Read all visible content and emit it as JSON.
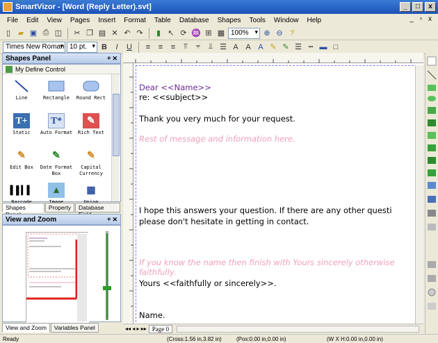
{
  "window": {
    "title": "SmartVizor - [Word (Reply Letter).svt]",
    "controls": [
      "_",
      "□",
      "x"
    ]
  },
  "menu": [
    "File",
    "Edit",
    "View",
    "Pages",
    "Insert",
    "Format",
    "Table",
    "Database",
    "Shapes",
    "Tools",
    "Window",
    "Help"
  ],
  "toolbar": {
    "zoom": "100%",
    "font_name": "Times New Roman",
    "font_size": "10 pt."
  },
  "shapes_panel": {
    "title": "Shapes Panel",
    "category": "My Define Control",
    "items": [
      {
        "label": "Line",
        "icon": "line-icon"
      },
      {
        "label": "Rectangle",
        "icon": "rectangle-icon"
      },
      {
        "label": "Round Rect",
        "icon": "round-rect-icon"
      },
      {
        "label": "Static",
        "icon": "static-text-icon"
      },
      {
        "label": "Auto Format",
        "icon": "auto-format-icon"
      },
      {
        "label": "Rich Text",
        "icon": "rich-text-icon"
      },
      {
        "label": "Edit Box",
        "icon": "edit-box-icon"
      },
      {
        "label": "Date Format Box",
        "icon": "date-format-icon"
      },
      {
        "label": "Capital Currency",
        "icon": "capital-currency-icon"
      },
      {
        "label": "Barcode",
        "icon": "barcode-icon"
      },
      {
        "label": "Image",
        "icon": "image-icon"
      },
      {
        "label": "Union",
        "icon": "union-icon"
      }
    ],
    "tabs": [
      "Shapes Panel",
      "Property",
      "Database Field"
    ]
  },
  "view_zoom": {
    "title": "View and Zoom",
    "tabs": [
      "View and Zoom",
      "Variables Panel"
    ]
  },
  "document": {
    "lines": [
      {
        "text": "Dear <<Name>>",
        "style": "purple"
      },
      {
        "text": "re:  <<subject>>",
        "style": "normal"
      },
      {
        "text": "Thank you very much for your request.",
        "style": "normal"
      },
      {
        "text": "Rest of message and information here.",
        "style": "pink"
      },
      {
        "text": "I hope this answers your question.  If there are any other questi",
        "style": "normal"
      },
      {
        "text": "please don't hesitate in getting in contact.",
        "style": "normal"
      },
      {
        "text": "If you know the name then finish with Yours sincerely otherwise",
        "style": "pink"
      },
      {
        "text": "faithfully.",
        "style": "pink"
      },
      {
        "text": "Yours <<faithfully or sincerely>>.",
        "style": "normal"
      },
      {
        "text": "Name.",
        "style": "normal"
      }
    ]
  },
  "page_tab": "Page  0",
  "status": {
    "ready": "Ready",
    "cross": "(Cross:1.56 in,3.82 in)",
    "pos": "(Pos:0.00 in,0.00 in)",
    "size": "(W X H:0.00 in,0.00 in)"
  }
}
